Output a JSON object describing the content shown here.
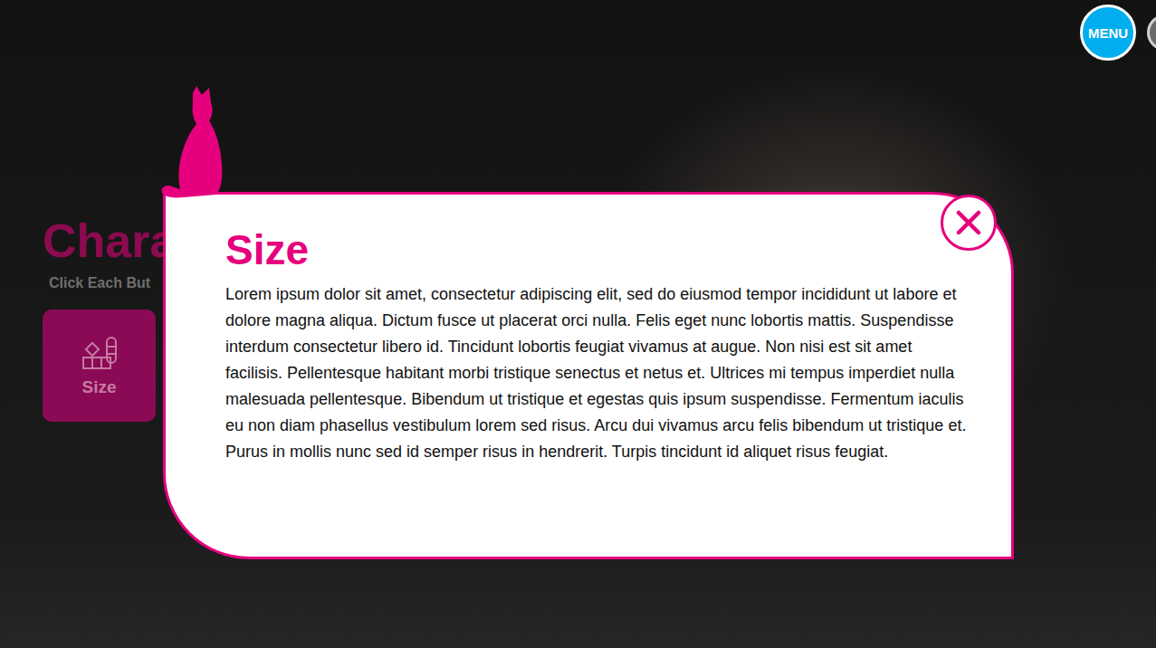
{
  "header": {
    "menu_button": "MENU"
  },
  "page": {
    "title": "Chara",
    "subtitle": "Click Each But",
    "cards": [
      {
        "label": "Size",
        "selected": true
      }
    ]
  },
  "modal": {
    "title": "Size",
    "body": "Lorem ipsum dolor sit amet, consectetur adipiscing elit, sed do eiusmod tempor incididunt ut labore et dolore magna aliqua. Dictum fusce ut placerat orci nulla. Felis eget nunc lobortis mattis. Suspendisse interdum consectetur libero id. Tincidunt lobortis feugiat vivamus at augue. Non nisi est sit amet facilisis. Pellentesque habitant morbi tristique senectus et netus et. Ultrices mi tempus imperdiet nulla malesuada pellentesque. Bibendum ut tristique et egestas quis ipsum suspendisse. Fermentum iaculis eu non diam phasellus vestibulum lorem sed risus. Arcu dui vivamus arcu felis bibendum ut tristique et. Purus in mollis nunc sed id semper risus in hendrerit. Turpis tincidunt id aliquet risus feugiat."
  }
}
